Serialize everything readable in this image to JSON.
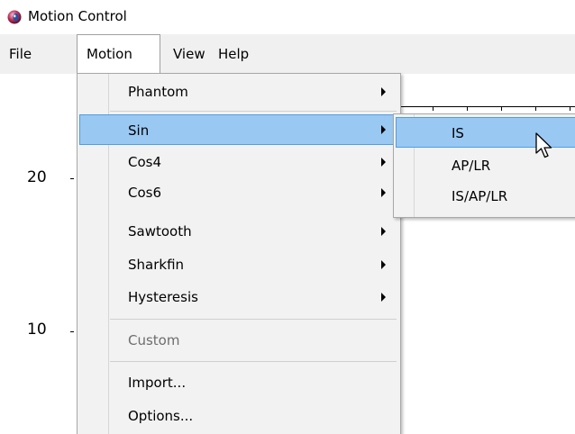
{
  "window": {
    "title": "Motion Control"
  },
  "menubar": {
    "items": [
      {
        "label": "File"
      },
      {
        "label": "Motion"
      },
      {
        "label": "View"
      },
      {
        "label": "Help"
      }
    ],
    "open_item": "Motion"
  },
  "plot": {
    "y_tick_labels": [
      "20",
      "10"
    ]
  },
  "motion_menu": {
    "items": [
      {
        "label": "Phantom",
        "has_submenu": true
      },
      {
        "label": "Sin",
        "has_submenu": true,
        "highlighted": true
      },
      {
        "label": "Cos4",
        "has_submenu": true
      },
      {
        "label": "Cos6",
        "has_submenu": true
      },
      {
        "label": "Sawtooth",
        "has_submenu": true
      },
      {
        "label": "Sharkfin",
        "has_submenu": true
      },
      {
        "label": "Hysteresis",
        "has_submenu": true
      },
      {
        "label": "Custom",
        "disabled": true
      },
      {
        "label": "Import..."
      },
      {
        "label": "Options..."
      }
    ]
  },
  "sin_submenu": {
    "items": [
      {
        "label": "IS",
        "highlighted": true
      },
      {
        "label": "AP/LR"
      },
      {
        "label": "IS/AP/LR"
      }
    ]
  },
  "colors": {
    "menu_background": "#f2f2f2",
    "highlight_fill": "#99c8f3",
    "highlight_border": "#4f9ee2",
    "disabled_text": "#6d6d6d",
    "menubar_background": "#f0f0f0"
  },
  "icons": {
    "app": "app-icon",
    "submenu_arrow": "chevron-right-icon",
    "cursor": "mouse-pointer-icon"
  }
}
